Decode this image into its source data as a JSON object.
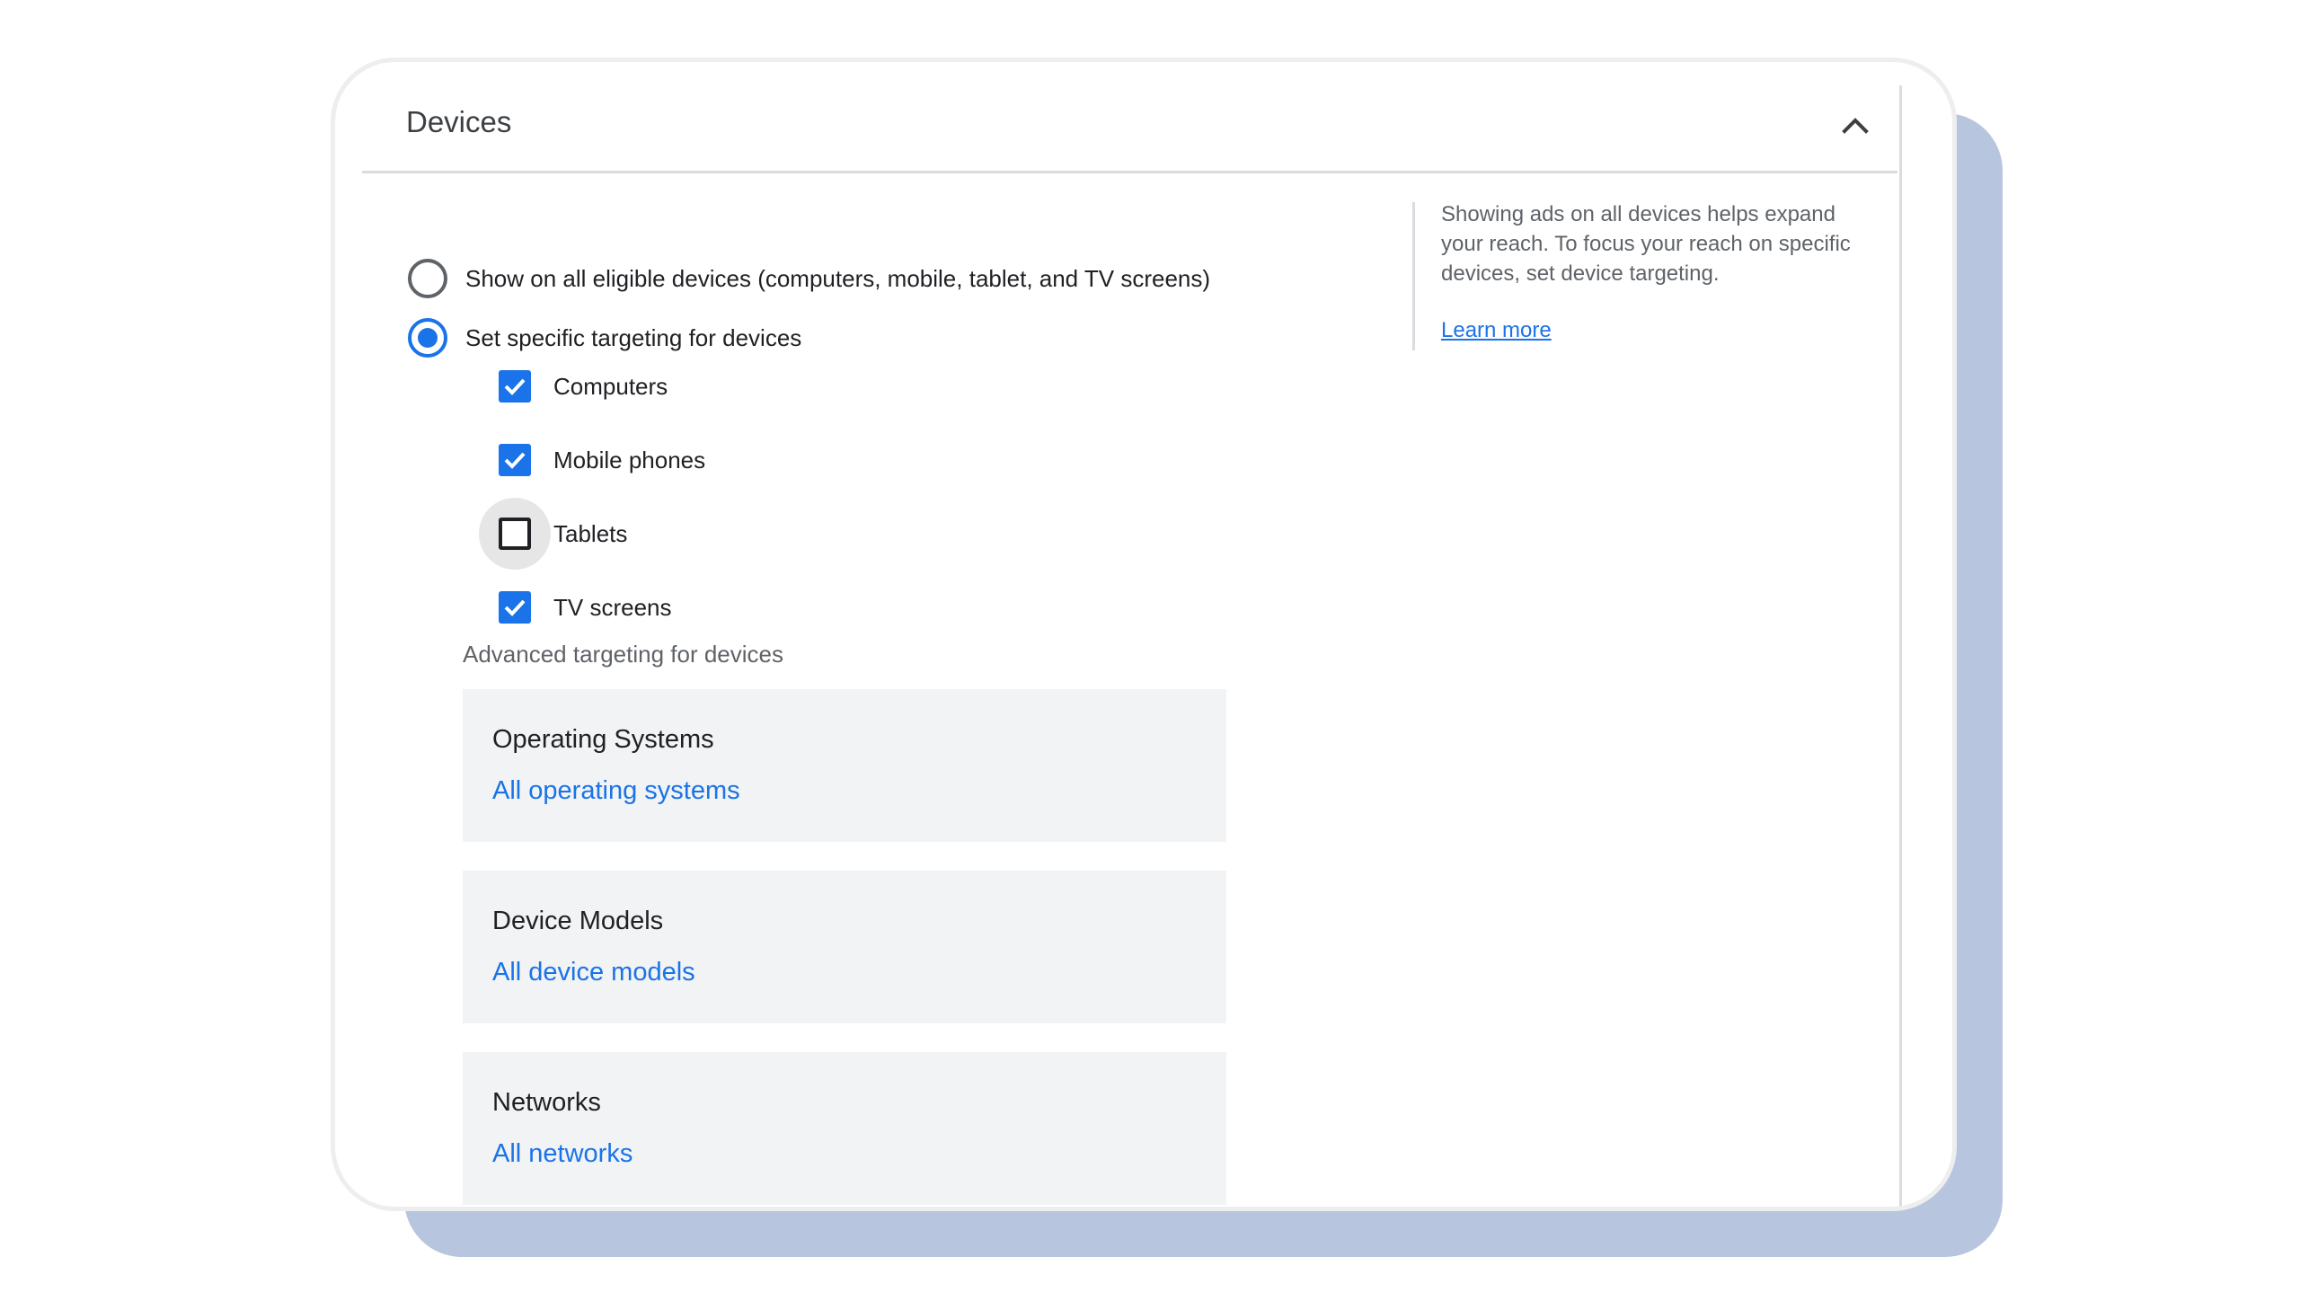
{
  "header": {
    "title": "Devices",
    "collapse_icon": "chevron-up-icon"
  },
  "targeting": {
    "options": [
      {
        "label": "Show on all eligible devices (computers, mobile, tablet, and TV screens)",
        "selected": false
      },
      {
        "label": "Set specific targeting for devices",
        "selected": true
      }
    ],
    "devices": [
      {
        "label": "Computers",
        "checked": true
      },
      {
        "label": "Mobile phones",
        "checked": true
      },
      {
        "label": "Tablets",
        "checked": false
      },
      {
        "label": "TV screens",
        "checked": true
      }
    ]
  },
  "advanced": {
    "label": "Advanced targeting for devices",
    "sections": [
      {
        "title": "Operating Systems",
        "value": "All operating systems"
      },
      {
        "title": "Device Models",
        "value": "All device models"
      },
      {
        "title": "Networks",
        "value": "All networks"
      }
    ]
  },
  "info": {
    "text": "Showing ads on all devices helps expand your reach. To focus your reach on specific devices, set device targeting.",
    "link": "Learn more"
  },
  "colors": {
    "accent": "#1a73e8",
    "backdrop": "#b7c5de",
    "section_bg": "#f1f3f4"
  }
}
